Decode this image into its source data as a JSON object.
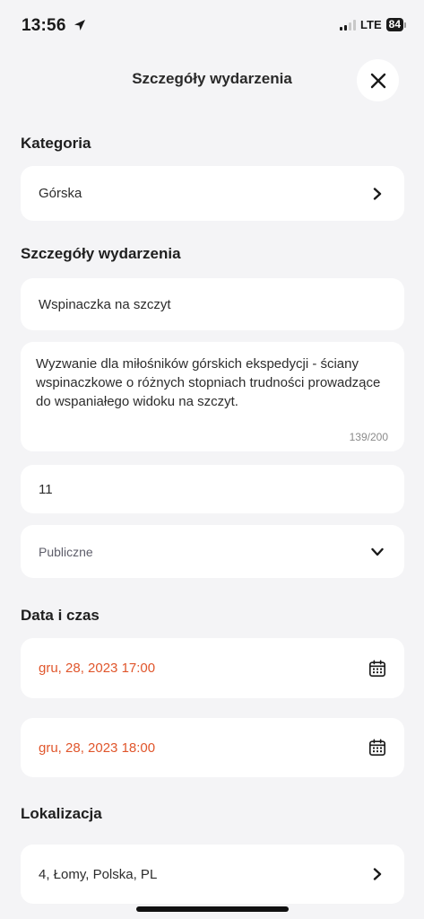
{
  "status_bar": {
    "time": "13:56",
    "network": "LTE",
    "battery": "84"
  },
  "header": {
    "title": "Szczegóły wydarzenia",
    "close_icon": "close-icon"
  },
  "category": {
    "label": "Kategoria",
    "value": "Górska"
  },
  "details": {
    "label": "Szczegóły wydarzenia",
    "name": "Wspinaczka na szczyt",
    "description": "Wyzwanie dla miłośników górskich ekspedycji - ściany wspinaczkowe o różnych stopniach trudności prowadzące do wspaniałego widoku na szczyt.",
    "char_count": "139/200",
    "participants": "11",
    "visibility": "Publiczne"
  },
  "datetime": {
    "label": "Data i czas",
    "start": "gru, 28, 2023 17:00",
    "end": "gru, 28, 2023 18:00"
  },
  "location": {
    "label": "Lokalizacja",
    "value": "4, Łomy, Polska, PL"
  },
  "colors": {
    "accent": "#e0562c",
    "background": "#f4f4f6",
    "card": "#ffffff"
  }
}
